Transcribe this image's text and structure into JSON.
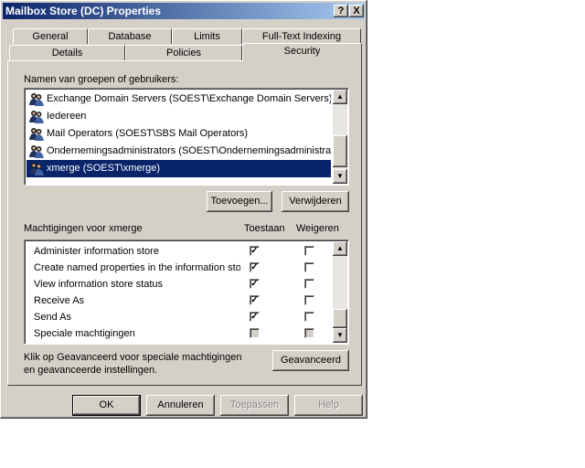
{
  "window": {
    "title": "Mailbox Store (DC) Properties",
    "help_btn": "?",
    "close_btn": "X"
  },
  "tabs": {
    "row1": [
      "General",
      "Database",
      "Limits",
      "Full-Text Indexing"
    ],
    "row2": [
      "Details",
      "Policies",
      "Security"
    ],
    "active": "Security"
  },
  "groups": {
    "label": "Namen van groepen of gebruikers:",
    "items": [
      {
        "name": "Exchange Domain Servers (SOEST\\Exchange Domain Servers)",
        "selected": false
      },
      {
        "name": "Iedereen",
        "selected": false
      },
      {
        "name": "Mail Operators (SOEST\\SBS Mail Operators)",
        "selected": false
      },
      {
        "name": "Ondernemingsadministrators (SOEST\\Ondernemingsadministrat...",
        "selected": false
      },
      {
        "name": "xmerge (SOEST\\xmerge)",
        "selected": true
      }
    ],
    "add_btn": "Toevoegen...",
    "remove_btn": "Verwijderen"
  },
  "permissions": {
    "label": "Machtigingen voor xmerge",
    "allow_header": "Toestaan",
    "deny_header": "Weigeren",
    "rows": [
      {
        "name": "Administer information store",
        "allow": true,
        "deny": false
      },
      {
        "name": "Create named properties in the information store",
        "allow": true,
        "deny": false
      },
      {
        "name": "View information store status",
        "allow": true,
        "deny": false
      },
      {
        "name": "Receive As",
        "allow": true,
        "deny": false
      },
      {
        "name": "Send As",
        "allow": true,
        "deny": false
      },
      {
        "name": "Speciale machtigingen",
        "allow": false,
        "deny": false,
        "greyed": true
      }
    ]
  },
  "advanced": {
    "text": "Klik op Geavanceerd voor speciale machtigingen en geavanceerde instellingen.",
    "btn": "Geavanceerd"
  },
  "footer": {
    "ok": "OK",
    "cancel": "Annuleren",
    "apply": "Toepassen",
    "help": "Help"
  }
}
